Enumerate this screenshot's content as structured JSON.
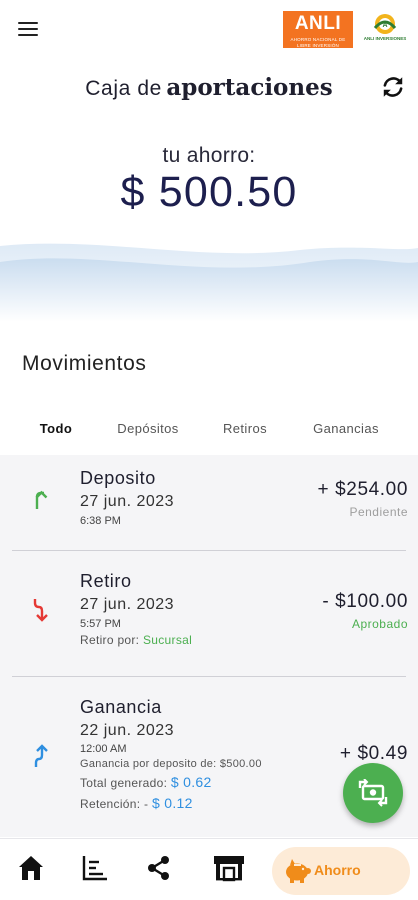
{
  "header": {
    "logo_main": "ANLI",
    "logo_main_sub": "AHORRO NACIONAL DE LIBRE INVERSIÓN",
    "logo_secondary": "ANLI INVERSIONES"
  },
  "title": {
    "light": "Caja de",
    "bold": "aportaciones"
  },
  "savings": {
    "label": "tu ahorro:",
    "amount": "$ 500.50"
  },
  "movements": {
    "section_title": "Movimientos",
    "tabs": [
      {
        "label": "Todo",
        "active": true
      },
      {
        "label": "Depósitos",
        "active": false
      },
      {
        "label": "Retiros",
        "active": false
      },
      {
        "label": "Ganancias",
        "active": false
      }
    ],
    "items": [
      {
        "type": "Deposito",
        "date": "27 jun. 2023",
        "time": "6:38 PM",
        "amount": "+ $254.00",
        "status": "Pendiente",
        "direction": "up",
        "icon_color": "#4caf50",
        "status_color": "#9e9e9e"
      },
      {
        "type": "Retiro",
        "date": "27 jun. 2023",
        "time": "5:57 PM",
        "withdraw_label": "Retiro por:",
        "withdraw_value": "Sucursal",
        "amount": "- $100.00",
        "status": "Aprobado",
        "direction": "down",
        "icon_color": "#e53935",
        "status_color": "#4caf50"
      },
      {
        "type": "Ganancia",
        "date": "22 jun. 2023",
        "time": "12:00 AM",
        "detail": "Ganancia por deposito de: $500.00",
        "total_label": "Total generado:",
        "total_value": "$ 0.62",
        "retention_label": "Retención: -",
        "retention_value": "$ 0.12",
        "amount": "+ $0.49",
        "direction": "up",
        "icon_color": "#2f8fe0"
      }
    ]
  },
  "bottom_nav": {
    "items": [
      "home-icon",
      "chart-icon",
      "share-icon",
      "store-icon"
    ],
    "active_label": "Ahorro",
    "active_color": "#f08c1a"
  },
  "colors": {
    "fab": "#4caf50",
    "amount_text": "#1d1f4e",
    "logo_orange": "#f37321"
  }
}
